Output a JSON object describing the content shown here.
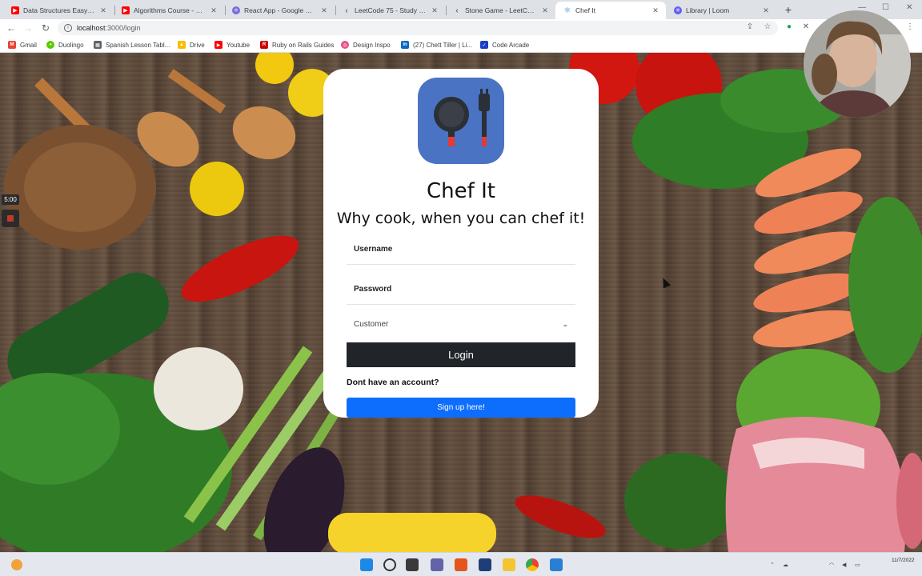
{
  "browser": {
    "tabs": [
      {
        "title": "Data Structures Easy to Ad",
        "icon": "youtube-icon",
        "color": "#ff0000"
      },
      {
        "title": "Algorithms Course - Graph",
        "icon": "youtube-icon",
        "color": "#ff0000"
      },
      {
        "title": "React App - Google Chro",
        "icon": "react-icon",
        "color": "#7b6cd9"
      },
      {
        "title": "LeetCode 75 - Study Plan",
        "icon": "leetcode-icon",
        "color": "#3c4043"
      },
      {
        "title": "Stone Game - LeetCode",
        "icon": "leetcode-icon",
        "color": "#3c4043"
      },
      {
        "title": "Chef It",
        "icon": "react-icon",
        "color": "#2a8bd6",
        "active": true
      },
      {
        "title": "Library | Loom",
        "icon": "loom-icon",
        "color": "#625df5"
      }
    ],
    "url_host": "localhost",
    "url_path": ":3000/login"
  },
  "bookmarks": [
    {
      "label": "Gmail",
      "icon": "gmail-icon",
      "color": "#ea4335"
    },
    {
      "label": "Duolingo",
      "icon": "duolingo-icon",
      "color": "#58cc02"
    },
    {
      "label": "Spanish Lesson Tabl...",
      "icon": "table-icon",
      "color": "#5f6368"
    },
    {
      "label": "Drive",
      "icon": "drive-icon",
      "color": "#fbbc04"
    },
    {
      "label": "Youtube",
      "icon": "youtube-icon",
      "color": "#ff0000"
    },
    {
      "label": "Ruby on Rails Guides",
      "icon": "rails-icon",
      "color": "#cc0000"
    },
    {
      "label": "Design Inspo",
      "icon": "dribbble-icon",
      "color": "#ea4c89"
    },
    {
      "label": "(27) Chett Tiller | Li...",
      "icon": "linkedin-icon",
      "color": "#0a66c2"
    },
    {
      "label": "Code Arcade",
      "icon": "code-arcade-icon",
      "color": "#1a3fc4"
    }
  ],
  "login": {
    "title": "Chef It",
    "tagline": "Why cook, when you can chef it!",
    "username_placeholder": "Username",
    "password_placeholder": "Password",
    "role_selected": "Customer",
    "login_label": "Login",
    "no_account_text": "Dont have an account?",
    "signup_label": "Sign up here!"
  },
  "recorder": {
    "timer": "5:00"
  },
  "taskbar": {
    "date": "11/7/2022"
  },
  "colors": {
    "primary_button": "#0d6efd",
    "dark_button": "#212529",
    "logo_bg": "#4a73c4"
  }
}
